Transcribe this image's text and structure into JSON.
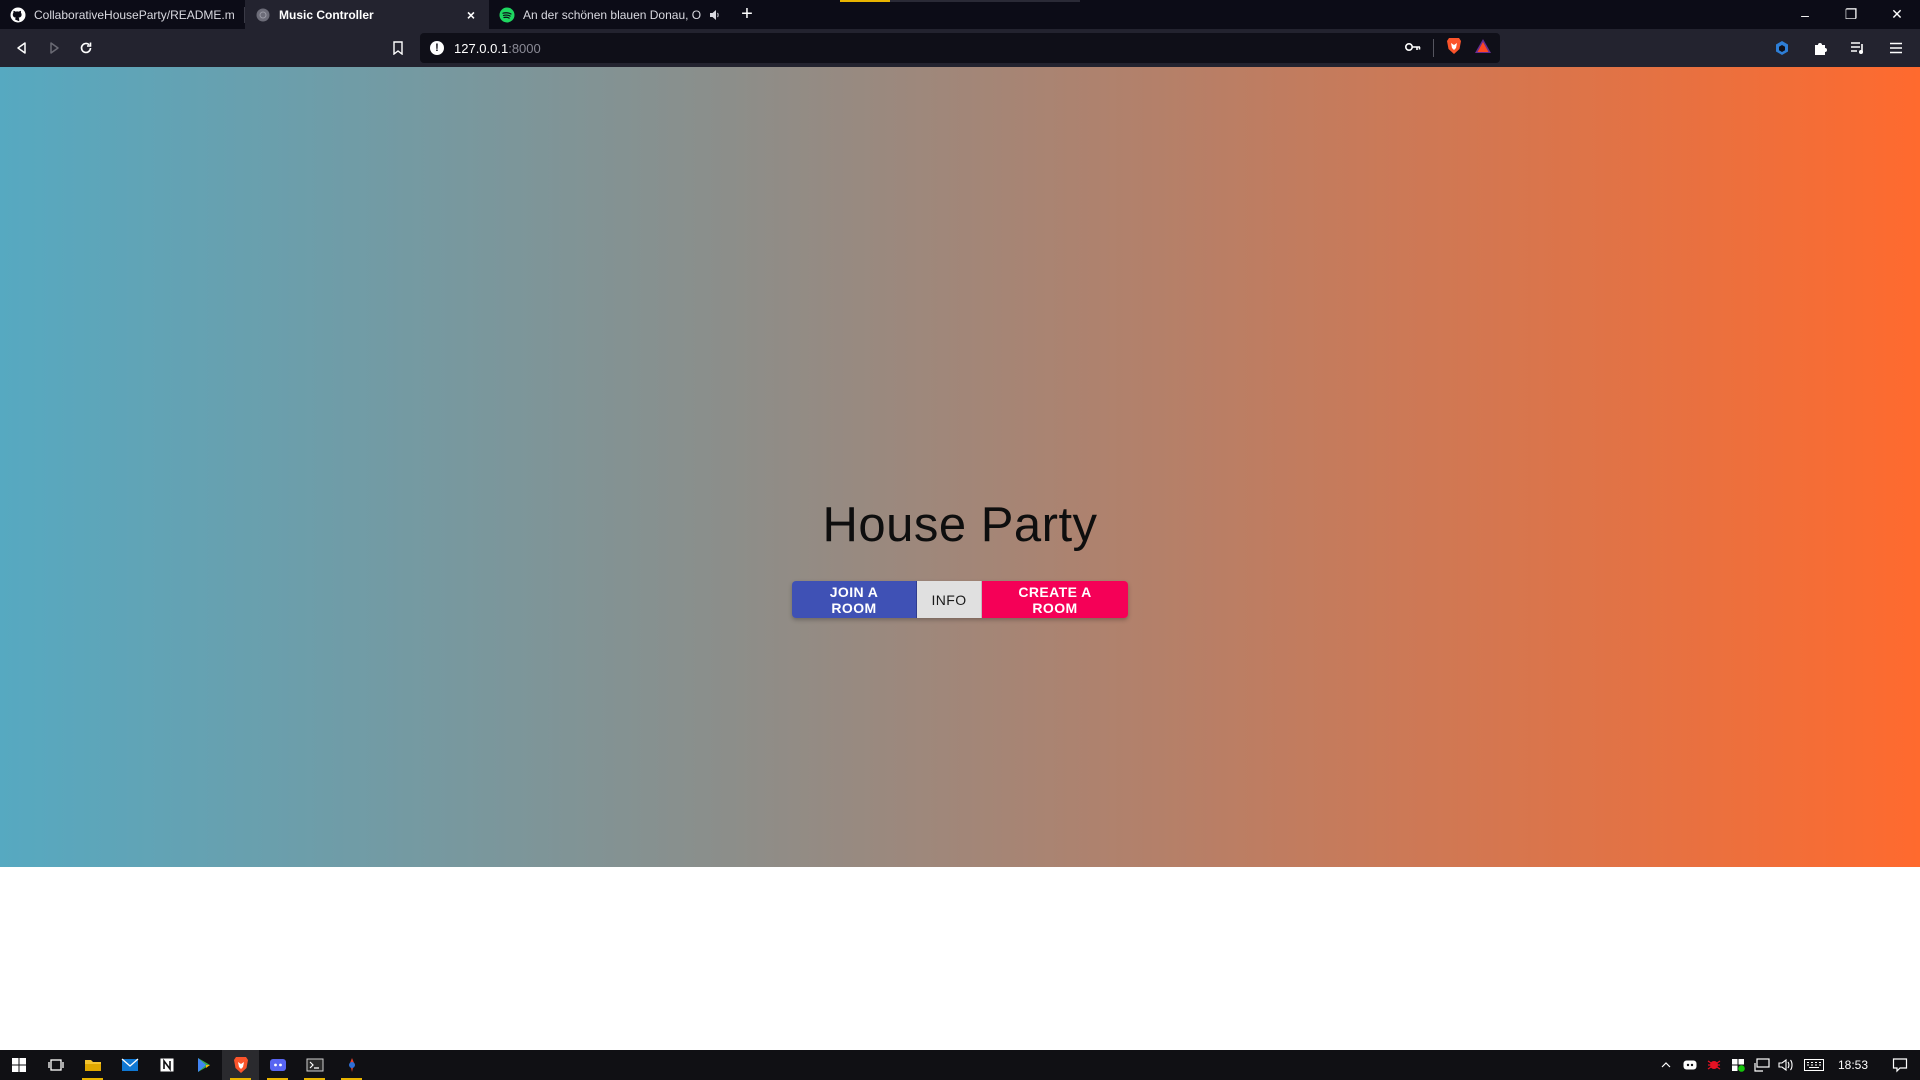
{
  "browser": {
    "tabs": [
      {
        "title": "CollaborativeHouseParty/README.md",
        "icon": "github-icon",
        "active": false
      },
      {
        "title": "Music Controller",
        "icon": "globe-icon",
        "active": true
      },
      {
        "title": "An der schönen blauen Donau, Op",
        "icon": "spotify-icon",
        "active": false,
        "audio": true
      }
    ],
    "new_tab_label": "+",
    "close_label": "×",
    "url": {
      "host": "127.0.0.1",
      "port": ":8000"
    },
    "window_controls": {
      "minimize": "–",
      "restore": "❐",
      "close": "✕"
    }
  },
  "page": {
    "title": "House Party",
    "buttons": {
      "join": "JOIN A ROOM",
      "info": "INFO",
      "create": "CREATE A ROOM"
    },
    "colors": {
      "gradient_start": "#56a9c1",
      "gradient_end": "#ff6a2e",
      "join_button": "#3f51b5",
      "info_button": "#e0e0e0",
      "create_button": "#f50057"
    }
  },
  "taskbar": {
    "apps": [
      "windows-start-icon",
      "task-view-icon",
      "file-explorer-icon",
      "mail-icon",
      "notion-icon",
      "google-play-icon",
      "brave-browser-icon",
      "discord-icon",
      "terminal-icon",
      "app-icon"
    ],
    "clock": "18:53"
  }
}
